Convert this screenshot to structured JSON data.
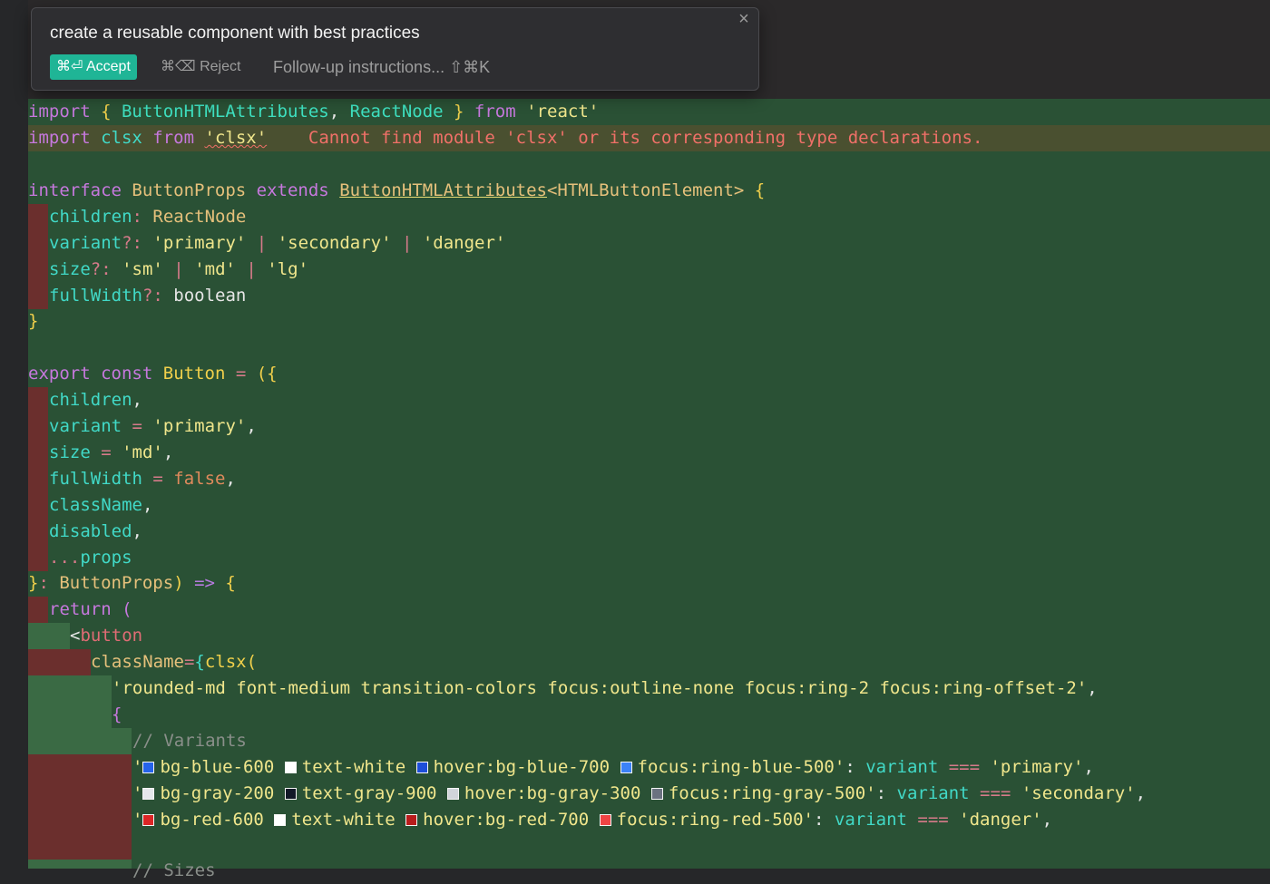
{
  "popup": {
    "prompt": "create a reusable component with best practices",
    "accept_label": "⌘⏎ Accept",
    "reject_label": "⌘⌫ Reject",
    "followup_placeholder": "Follow-up instructions... ⇧⌘K",
    "close_icon": "×"
  },
  "code": {
    "l1": {
      "t1": "import",
      "t2": " { ",
      "t3": "ButtonHTMLAttributes",
      "t4": ", ",
      "t5": "ReactNode",
      "t6": " } ",
      "t7": "from",
      "t8": " 'react'"
    },
    "l2": {
      "t1": "import",
      "t2": " clsx ",
      "t3": "from",
      "t4": " ",
      "t5": "'clsx'",
      "t6": "    Cannot find module 'clsx' or its corresponding type declarations."
    },
    "l4": {
      "t1": "interface",
      "t2": " ButtonProps ",
      "t3": "extends",
      "t4": " ",
      "t5": "ButtonHTMLAttributes",
      "t6": "<HTMLButtonElement>",
      "t7": " {"
    },
    "l5": {
      "t1": "children",
      "t2": ": ",
      "t3": "ReactNode"
    },
    "l6": {
      "t1": "variant",
      "t2": "?: ",
      "t3": "'primary'",
      "t4": " | ",
      "t5": "'secondary'",
      "t6": " | ",
      "t7": "'danger'"
    },
    "l7": {
      "t1": "size",
      "t2": "?: ",
      "t3": "'sm'",
      "t4": " | ",
      "t5": "'md'",
      "t6": " | ",
      "t7": "'lg'"
    },
    "l8": {
      "t1": "fullWidth",
      "t2": "?: ",
      "t3": "boolean"
    },
    "l9": {
      "t1": "}"
    },
    "l11": {
      "t1": "export",
      "t2": " ",
      "t3": "const",
      "t4": " ",
      "t5": "Button",
      "t6": " = ",
      "t7": "({"
    },
    "l12": {
      "t1": "children",
      ",": ","
    },
    "l13": {
      "t1": "variant",
      "t2": " = ",
      "t3": "'primary'",
      "t4": ","
    },
    "l14": {
      "t1": "size",
      "t2": " = ",
      "t3": "'md'",
      "t4": ","
    },
    "l15": {
      "t1": "fullWidth",
      "t2": " = ",
      "t3": "false",
      "t4": ","
    },
    "l16": {
      "t1": "className",
      "t2": ","
    },
    "l17": {
      "t1": "disabled",
      "t2": ","
    },
    "l18": {
      "t1": "...",
      "t2": "props"
    },
    "l19": {
      "t1": "}",
      "t2": ": ",
      "t3": "ButtonProps",
      "t4": ")",
      "t5": " => ",
      "t6": "{"
    },
    "l20": {
      "t1": "return",
      "t2": " ("
    },
    "l21": {
      "t1": "<",
      "t2": "button"
    },
    "l22": {
      "t1": "className",
      "t2": "=",
      "t3": "{",
      "t4": "clsx",
      "t5": "("
    },
    "l23": {
      "t1": "'rounded-md font-medium transition-colors focus:outline-none focus:ring-2 focus:ring-offset-2'",
      "t2": ","
    },
    "l24": {
      "t1": "{"
    },
    "l25": {
      "t1": "// Variants"
    },
    "l26": {
      "q": "'",
      "c1": "bg-blue-600",
      "c2": "text-white",
      "c3": "hover:bg-blue-700",
      "c4": "focus:ring-blue-500",
      "q2": "'",
      "t2": ": ",
      "t3": "variant",
      "t4": " === ",
      "t5": "'primary'",
      "t6": ","
    },
    "l27": {
      "q": "'",
      "c1": "bg-gray-200",
      "c2": "text-gray-900",
      "c3": "hover:bg-gray-300",
      "c4": "focus:ring-gray-500",
      "q2": "'",
      "t2": ": ",
      "t3": "variant",
      "t4": " === ",
      "t5": "'secondary'",
      "t6": ","
    },
    "l28": {
      "q": "'",
      "c1": "bg-red-600",
      "c2": "text-white",
      "c3": "hover:bg-red-700",
      "c4": "focus:ring-red-500",
      "q2": "'",
      "t2": ": ",
      "t3": "variant",
      "t4": " === ",
      "t5": "'danger'",
      "t6": ","
    },
    "l30": {
      "t1": "// Sizes"
    }
  },
  "swatches": {
    "blue600": "#2563eb",
    "white": "#ffffff",
    "blue700": "#1d4ed8",
    "blue500": "#3b82f6",
    "gray200": "#e5e7eb",
    "gray900": "#111827",
    "gray300": "#d1d5db",
    "gray500": "#6b7280",
    "red600": "#dc2626",
    "red700": "#b91c1c",
    "red500": "#ef4444"
  },
  "colors": {
    "accent": "#1fb596",
    "diff_added": "#2a5135",
    "diff_removed": "#6b2f2d",
    "error": "#f07068"
  }
}
